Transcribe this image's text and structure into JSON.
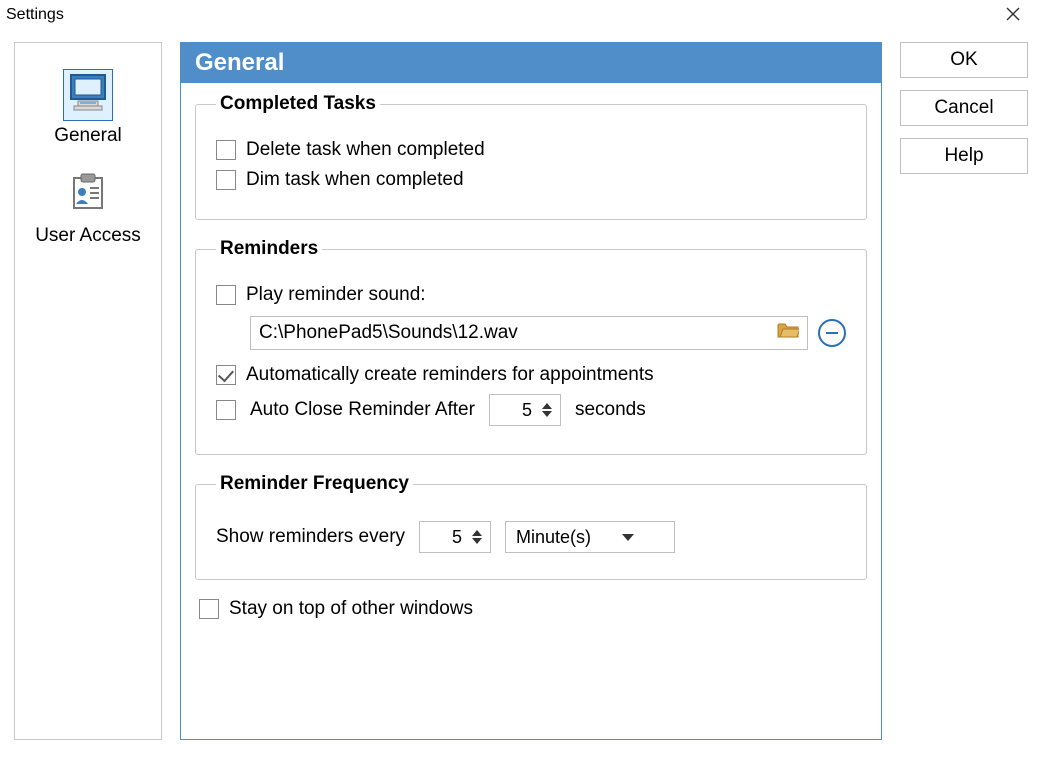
{
  "window": {
    "title": "Settings"
  },
  "sidebar": {
    "items": [
      {
        "label": "General",
        "selected": true
      },
      {
        "label": "User Access",
        "selected": false
      }
    ]
  },
  "content": {
    "title": "General",
    "groups": {
      "completed": {
        "legend": "Completed Tasks",
        "delete_label": "Delete task when completed",
        "delete_checked": false,
        "dim_label": "Dim task when completed",
        "dim_checked": false
      },
      "reminders": {
        "legend": "Reminders",
        "play_sound_label": "Play reminder sound:",
        "play_sound_checked": false,
        "sound_path": "C:\\PhonePad5\\Sounds\\12.wav",
        "auto_create_label": "Automatically create reminders for appointments",
        "auto_create_checked": true,
        "auto_close_label": "Auto Close Reminder After",
        "auto_close_checked": false,
        "auto_close_value": "5",
        "auto_close_unit": "seconds"
      },
      "frequency": {
        "legend": "Reminder Frequency",
        "label": "Show reminders every",
        "value": "5",
        "unit": "Minute(s)"
      }
    },
    "stay_on_top_label": "Stay on top of other windows",
    "stay_on_top_checked": false
  },
  "buttons": {
    "ok": "OK",
    "cancel": "Cancel",
    "help": "Help"
  }
}
